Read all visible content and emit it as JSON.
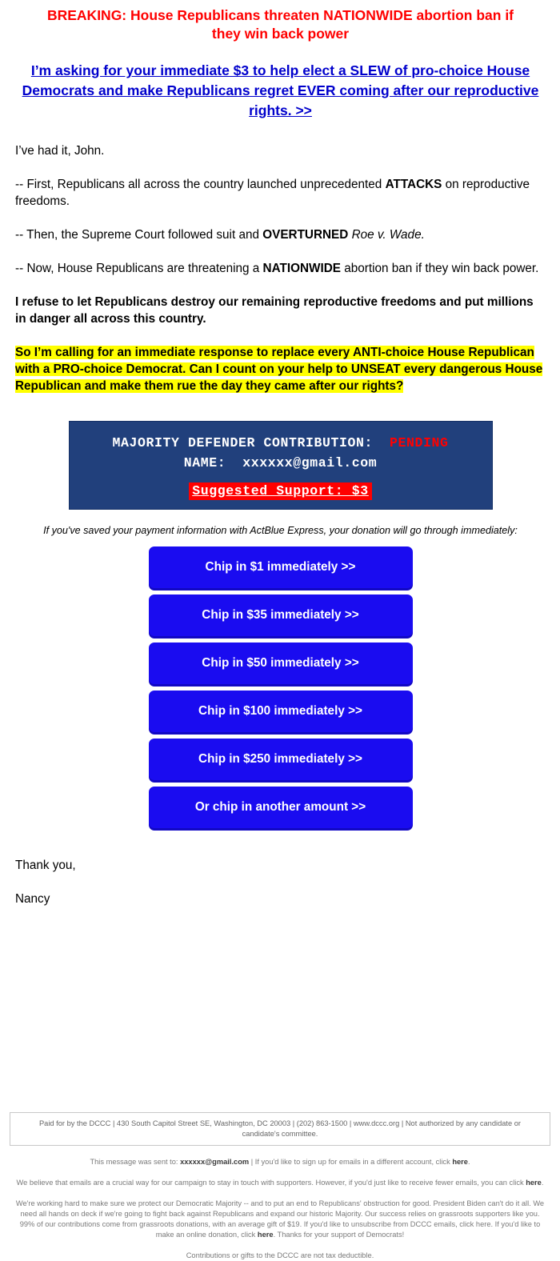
{
  "headline": {
    "breaking": "BREAKING: House Republicans threaten NATIONWIDE abortion ban if they win back power",
    "ask_link": "I’m asking for your immediate $3 to help elect a SLEW of pro-choice House Democrats and make Republicans regret EVER coming after our reproductive rights. >> "
  },
  "body": {
    "greeting": "I’ve had it, John.",
    "p1_a": "-- First, Republicans all across the country launched unprecedented ",
    "p1_bold": "ATTACKS",
    "p1_b": " on reproductive freedoms.",
    "p2_a": "-- Then, the Supreme Court followed suit and ",
    "p2_bold": "OVERTURNED",
    "p2_b": " ",
    "p2_italic": "Roe v. Wade.",
    "p3_a": "-- Now, House Republicans are threatening a ",
    "p3_bold": "NATIONWIDE",
    "p3_b": " abortion ban if they win back power.",
    "p4_bold": "I refuse to let Republicans destroy our remaining reproductive freedoms and put millions in danger all across this country.",
    "p5_highlight": "So I’m calling for an immediate response to replace every ANTI-choice House Republican with a PRO-choice Democrat. Can I count on your help to UNSEAT every dangerous House Republican and make them rue the day they came after our rights?"
  },
  "contribution": {
    "label": "MAJORITY DEFENDER CONTRIBUTION:",
    "status": "PENDING",
    "name_label": "NAME:",
    "name_value": "xxxxxx@gmail.com",
    "suggested": "Suggested Support: $3",
    "box_color": "#21407c",
    "status_color": "#ff0000",
    "suggested_bg": "#ff0000"
  },
  "express_note": "If you've saved your payment information with ActBlue Express, your donation will go through immediately:",
  "donate_buttons": [
    {
      "label": "Chip in $1 immediately >>",
      "amount": "1"
    },
    {
      "label": "Chip in $35 immediately >>",
      "amount": "35"
    },
    {
      "label": "Chip in $50 immediately >>",
      "amount": "50"
    },
    {
      "label": "Chip in $100 immediately >>",
      "amount": "100"
    },
    {
      "label": "Chip in $250 immediately >>",
      "amount": "250"
    },
    {
      "label": "Or chip in another amount >>",
      "amount": "other"
    }
  ],
  "button_color": "#1a0cf0",
  "signoff": {
    "thanks": "Thank you,",
    "name": "Nancy"
  },
  "footer": {
    "paid_for": "Paid for by the DCCC | 430 South Capitol Street SE, Washington, DC 20003 | (202) 863-1500 | www.dccc.org | Not authorized by any candidate or candidate's committee.",
    "sent_to_prefix": "This message was sent to: ",
    "sent_to_email": "xxxxxx@gmail.com",
    "sent_to_suffix_a": " | If you'd like to sign up for emails in a different account, click ",
    "sent_to_link": "here",
    "sent_to_suffix_b": ".",
    "fewer_a": "We believe that emails are a crucial way for our campaign to stay in touch with supporters. However, if you'd just like to receive fewer emails, you can click ",
    "fewer_link": "here",
    "fewer_b": ".",
    "long_a": "We're working hard to make sure we protect our Democratic Majority -- and to put an end to Republicans' obstruction for good. President Biden can't do it all. We need all hands on deck if we're going to fight back against Republicans and expand our historic Majority. Our success relies on grassroots supporters like you. 99% of our contributions come from grassroots donations, with an average gift of $19. If you'd like to unsubscribe from DCCC emails, click here. If you'd like to make an online donation, click ",
    "long_link": "here",
    "long_b": ". Thanks for your support of Democrats!",
    "tax": "Contributions or gifts to the DCCC are not tax deductible."
  }
}
